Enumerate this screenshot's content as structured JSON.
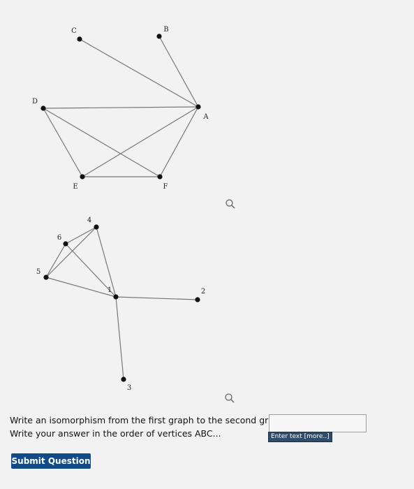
{
  "graph1": {
    "vertices": [
      "A",
      "B",
      "C",
      "D",
      "E",
      "F"
    ],
    "edges": [
      [
        "C",
        "A"
      ],
      [
        "B",
        "A"
      ],
      [
        "D",
        "A"
      ],
      [
        "D",
        "E"
      ],
      [
        "D",
        "F"
      ],
      [
        "E",
        "F"
      ],
      [
        "E",
        "A"
      ],
      [
        "F",
        "A"
      ]
    ]
  },
  "graph2": {
    "vertices": [
      "1",
      "2",
      "3",
      "4",
      "5",
      "6"
    ],
    "edges": [
      [
        "6",
        "4"
      ],
      [
        "4",
        "5"
      ],
      [
        "4",
        "1"
      ],
      [
        "6",
        "1"
      ],
      [
        "6",
        "5"
      ],
      [
        "5",
        "1"
      ],
      [
        "1",
        "2"
      ],
      [
        "1",
        "3"
      ]
    ]
  },
  "question": {
    "line1": "Write an isomorphism from the first graph to the second graph.",
    "line2": "Write your answer in the order of vertices ABC...",
    "input_value": "",
    "input_hint": "Enter text [more..]"
  },
  "submit_label": "Submit Question",
  "icons": [
    "zoom-icon"
  ]
}
